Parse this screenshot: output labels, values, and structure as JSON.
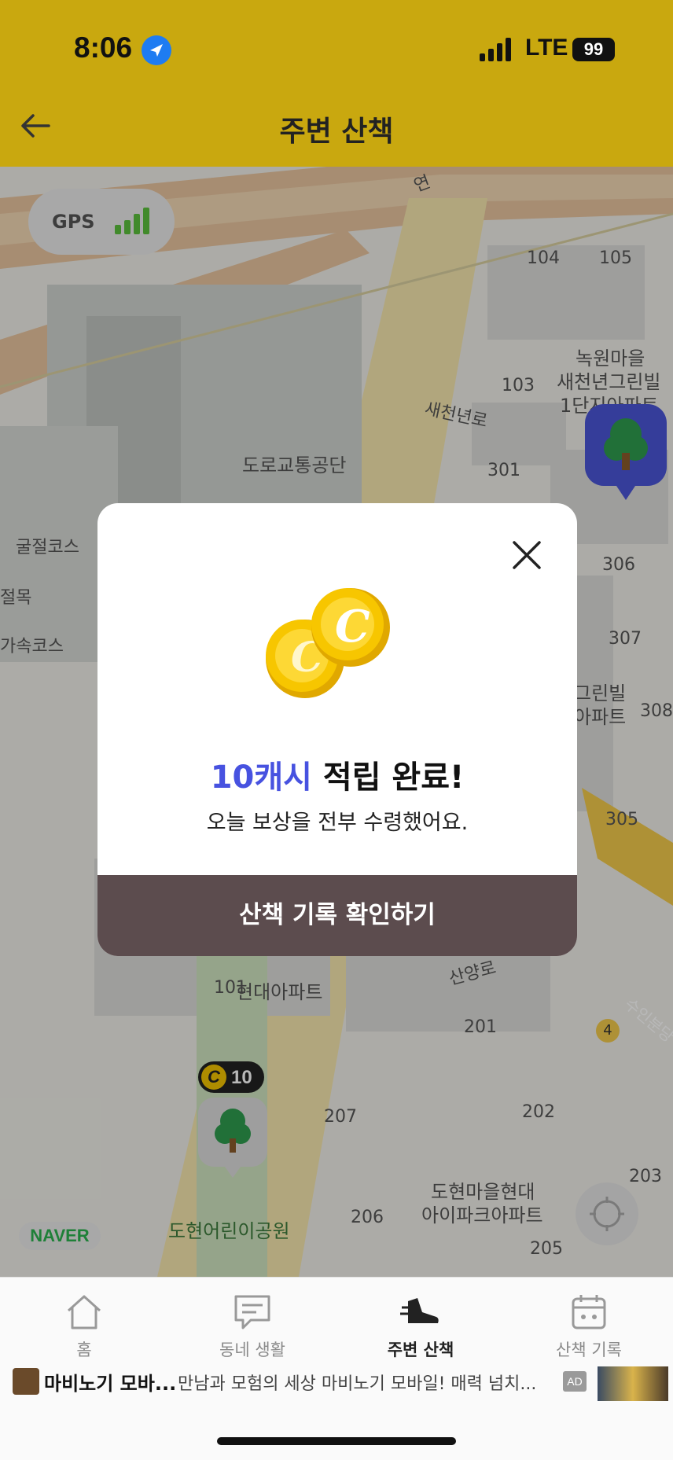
{
  "status_bar": {
    "time": "8:06",
    "network": "LTE",
    "battery": "99"
  },
  "header": {
    "title": "주변 산책",
    "back_icon": "arrow-left-icon"
  },
  "map": {
    "gps_label": "GPS",
    "provider": "NAVER",
    "labels": [
      "104",
      "105",
      "녹원마을",
      "새천년그린빌",
      "1단지아파트",
      "103",
      "새천년로",
      "도로교통공단",
      "301",
      "306",
      "307",
      "그린빌",
      "아파트",
      "308",
      "305",
      "굴절코스",
      "절목",
      "가속코스",
      "101",
      "현대아파트",
      "산양로",
      "201",
      "207",
      "202",
      "203",
      "도현마을현대",
      "아이파크아파트",
      "206",
      "205",
      "도현어린이공원",
      "4",
      "수인분당",
      "연"
    ],
    "coin_badge": {
      "icon": "C",
      "value": "10"
    }
  },
  "modal": {
    "headline_accent": "10캐시",
    "headline_rest": " 적립 완료!",
    "subtitle": "오늘 보상을 전부 수령했어요.",
    "cta_label": "산책 기록 확인하기"
  },
  "bottom_nav": [
    {
      "label": "홈",
      "icon": "home-icon",
      "active": false
    },
    {
      "label": "동네 생활",
      "icon": "chat-icon",
      "active": false
    },
    {
      "label": "주변 산책",
      "icon": "shoe-icon",
      "active": true
    },
    {
      "label": "산책 기록",
      "icon": "calendar-icon",
      "active": false
    }
  ],
  "ad": {
    "title": "마비노기 모바...",
    "description": "만남과 모험의 세상 마비노기 모바일! 매력 넘치...",
    "badge": "AD"
  },
  "colors": {
    "header": "#c9a80f",
    "accent": "#4752e0",
    "cta": "#5c4c4e",
    "gps_signal": "#5bbf3c"
  }
}
